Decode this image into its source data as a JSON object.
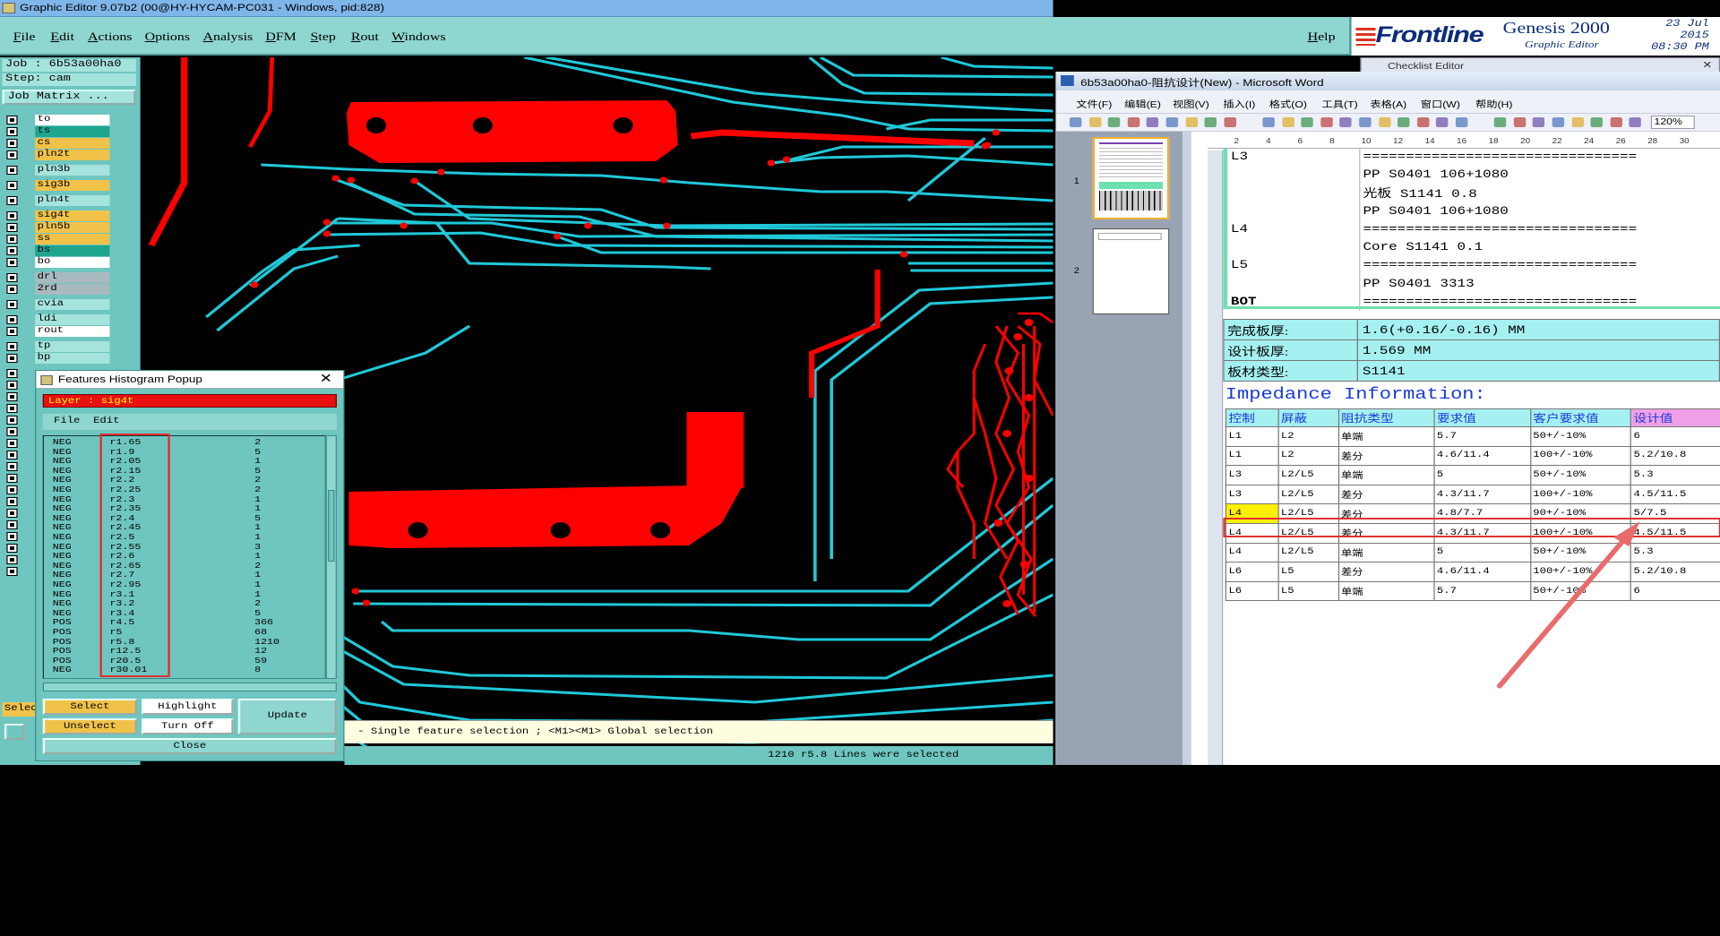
{
  "app": {
    "title": "Graphic Editor 9.07b2 (00@HY-HYCAM-PC031 - Windows, pid:828)",
    "menu": [
      "File",
      "Edit",
      "Actions",
      "Options",
      "Analysis",
      "DFM",
      "Step",
      "Rout",
      "Windows"
    ],
    "help": "Help",
    "logo_brand": "Frontline",
    "logo_product": "Genesis 2000",
    "logo_sub": "Graphic Editor",
    "date": "23 Jul 2015",
    "time": "08:30 PM"
  },
  "left_panel": {
    "job": "Job : 6b53a00ha0",
    "step": "Step: cam",
    "job_matrix": "Job Matrix ...",
    "layers": [
      {
        "name": "to",
        "color": "#ffffff"
      },
      {
        "name": "ts",
        "color": "#1fa58f"
      },
      {
        "name": "cs",
        "color": "#f0c24a"
      },
      {
        "name": "pln2t",
        "color": "#f0c24a"
      },
      {
        "name": "pln3b",
        "color": "#a5e3dd"
      },
      {
        "name": "sig3b",
        "color": "#f0c24a"
      },
      {
        "name": "pln4t",
        "color": "#a5e3dd"
      },
      {
        "name": "sig4t",
        "color": "#f0c24a"
      },
      {
        "name": "pln5b",
        "color": "#f0c24a"
      },
      {
        "name": "ss",
        "color": "#f0c24a"
      },
      {
        "name": "bs",
        "color": "#1fa58f"
      },
      {
        "name": "bo",
        "color": "#ffffff"
      },
      {
        "name": "drl",
        "color": "#a9b9c0"
      },
      {
        "name": "2rd",
        "color": "#a9b9c0"
      },
      {
        "name": "cvia",
        "color": "#a5e3dd"
      },
      {
        "name": "ldi",
        "color": "#a5e3dd"
      },
      {
        "name": "rout",
        "color": "#ffffff"
      },
      {
        "name": "tp",
        "color": "#a5e3dd"
      },
      {
        "name": "bp",
        "color": "#a5e3dd"
      }
    ],
    "select_stub": "Selec"
  },
  "histogram": {
    "title": "Features Histogram Popup",
    "layer": "Layer :  sig4t",
    "menu": [
      "File",
      "Edit"
    ],
    "rows": [
      [
        "NEG",
        "r1.65",
        "2"
      ],
      [
        "NEG",
        "r1.9",
        "5"
      ],
      [
        "NEG",
        "r2.05",
        "1"
      ],
      [
        "NEG",
        "r2.15",
        "5"
      ],
      [
        "NEG",
        "r2.2",
        "2"
      ],
      [
        "NEG",
        "r2.25",
        "2"
      ],
      [
        "NEG",
        "r2.3",
        "1"
      ],
      [
        "NEG",
        "r2.35",
        "1"
      ],
      [
        "NEG",
        "r2.4",
        "5"
      ],
      [
        "NEG",
        "r2.45",
        "1"
      ],
      [
        "NEG",
        "r2.5",
        "1"
      ],
      [
        "NEG",
        "r2.55",
        "3"
      ],
      [
        "NEG",
        "r2.6",
        "1"
      ],
      [
        "NEG",
        "r2.65",
        "2"
      ],
      [
        "NEG",
        "r2.7",
        "1"
      ],
      [
        "NEG",
        "r2.95",
        "1"
      ],
      [
        "NEG",
        "r3.1",
        "1"
      ],
      [
        "NEG",
        "r3.2",
        "2"
      ],
      [
        "NEG",
        "r3.4",
        "5"
      ],
      [
        "POS",
        "r4.5",
        "366"
      ],
      [
        "POS",
        "r5",
        "68"
      ],
      [
        "POS",
        "r5.8",
        "1210"
      ],
      [
        "POS",
        "r12.5",
        "12"
      ],
      [
        "POS",
        "r20.5",
        "59"
      ],
      [
        "NEG",
        "r30.01",
        "8"
      ]
    ],
    "buttons": {
      "select": "Select",
      "unselect": "Unselect",
      "highlight": "Highlight",
      "turn_off": "Turn Off",
      "update": "Update",
      "close": "Close"
    }
  },
  "status": {
    "hint": "- Single feature selection ; <M1><M1> Global selection",
    "selected": "1210 r5.8 Lines were selected"
  },
  "checklist": {
    "title": "Checklist Editor"
  },
  "word": {
    "title": "6b53a00ha0-阻抗设计(New) - Microsoft Word",
    "menu": [
      "文件(F)",
      "编辑(E)",
      "视图(V)",
      "插入(I)",
      "格式(O)",
      "工具(T)",
      "表格(A)",
      "窗口(W)",
      "帮助(H)"
    ],
    "zoom": "120%",
    "page_numbers": [
      "1",
      "2"
    ],
    "ruler_marks": [
      "2",
      "4",
      "6",
      "8",
      "10",
      "12",
      "14",
      "16",
      "18",
      "20",
      "22",
      "24",
      "26",
      "28",
      "30"
    ],
    "stackup": [
      {
        "layer": "L3",
        "content": "================================"
      },
      {
        "layer": "",
        "content": "PP     S0401     106+1080"
      },
      {
        "layer": "",
        "content": "光板       S1141      0.8"
      },
      {
        "layer": "",
        "content": "PP     S0401     106+1080"
      },
      {
        "layer": "L4",
        "content": "================================"
      },
      {
        "layer": "",
        "content": "Core     S1141     0.1"
      },
      {
        "layer": "L5",
        "content": "================================"
      },
      {
        "layer": "",
        "content": "PP     S0401     3313"
      },
      {
        "layer": "BOT",
        "content": "================================"
      }
    ],
    "board_info": [
      {
        "label": "完成板厚:",
        "value": "1.6(+0.16/-0.16) MM"
      },
      {
        "label": "设计板厚:",
        "value": "1.569 MM"
      },
      {
        "label": "板材类型:",
        "value": "S1141"
      }
    ],
    "impedance_title": "Impedance Information:",
    "imp_headers": [
      "控制",
      "屏蔽",
      "阻抗类型",
      "要求值",
      "客户要求值",
      "设计值"
    ],
    "imp_rows": [
      [
        "L1",
        "L2",
        "单端",
        "5.7",
        "50+/-10%",
        "6"
      ],
      [
        "L1",
        "L2",
        "差分",
        "4.6/11.4",
        "100+/-10%",
        "5.2/10.8"
      ],
      [
        "L3",
        "L2/L5",
        "单端",
        "5",
        "50+/-10%",
        "5.3"
      ],
      [
        "L3",
        "L2/L5",
        "差分",
        "4.3/11.7",
        "100+/-10%",
        "4.5/11.5"
      ],
      [
        "L4",
        "L2/L5",
        "差分",
        "4.8/7.7",
        "90+/-10%",
        "5/7.5"
      ],
      [
        "L4",
        "L2/L5",
        "差分",
        "4.3/11.7",
        "100+/-10%",
        "4.5/11.5"
      ],
      [
        "L4",
        "L2/L5",
        "单端",
        "5",
        "50+/-10%",
        "5.3"
      ],
      [
        "L6",
        "L5",
        "差分",
        "4.6/11.4",
        "100+/-10%",
        "5.2/10.8"
      ],
      [
        "L6",
        "L5",
        "单端",
        "5.7",
        "50+/-10%",
        "6"
      ]
    ]
  }
}
